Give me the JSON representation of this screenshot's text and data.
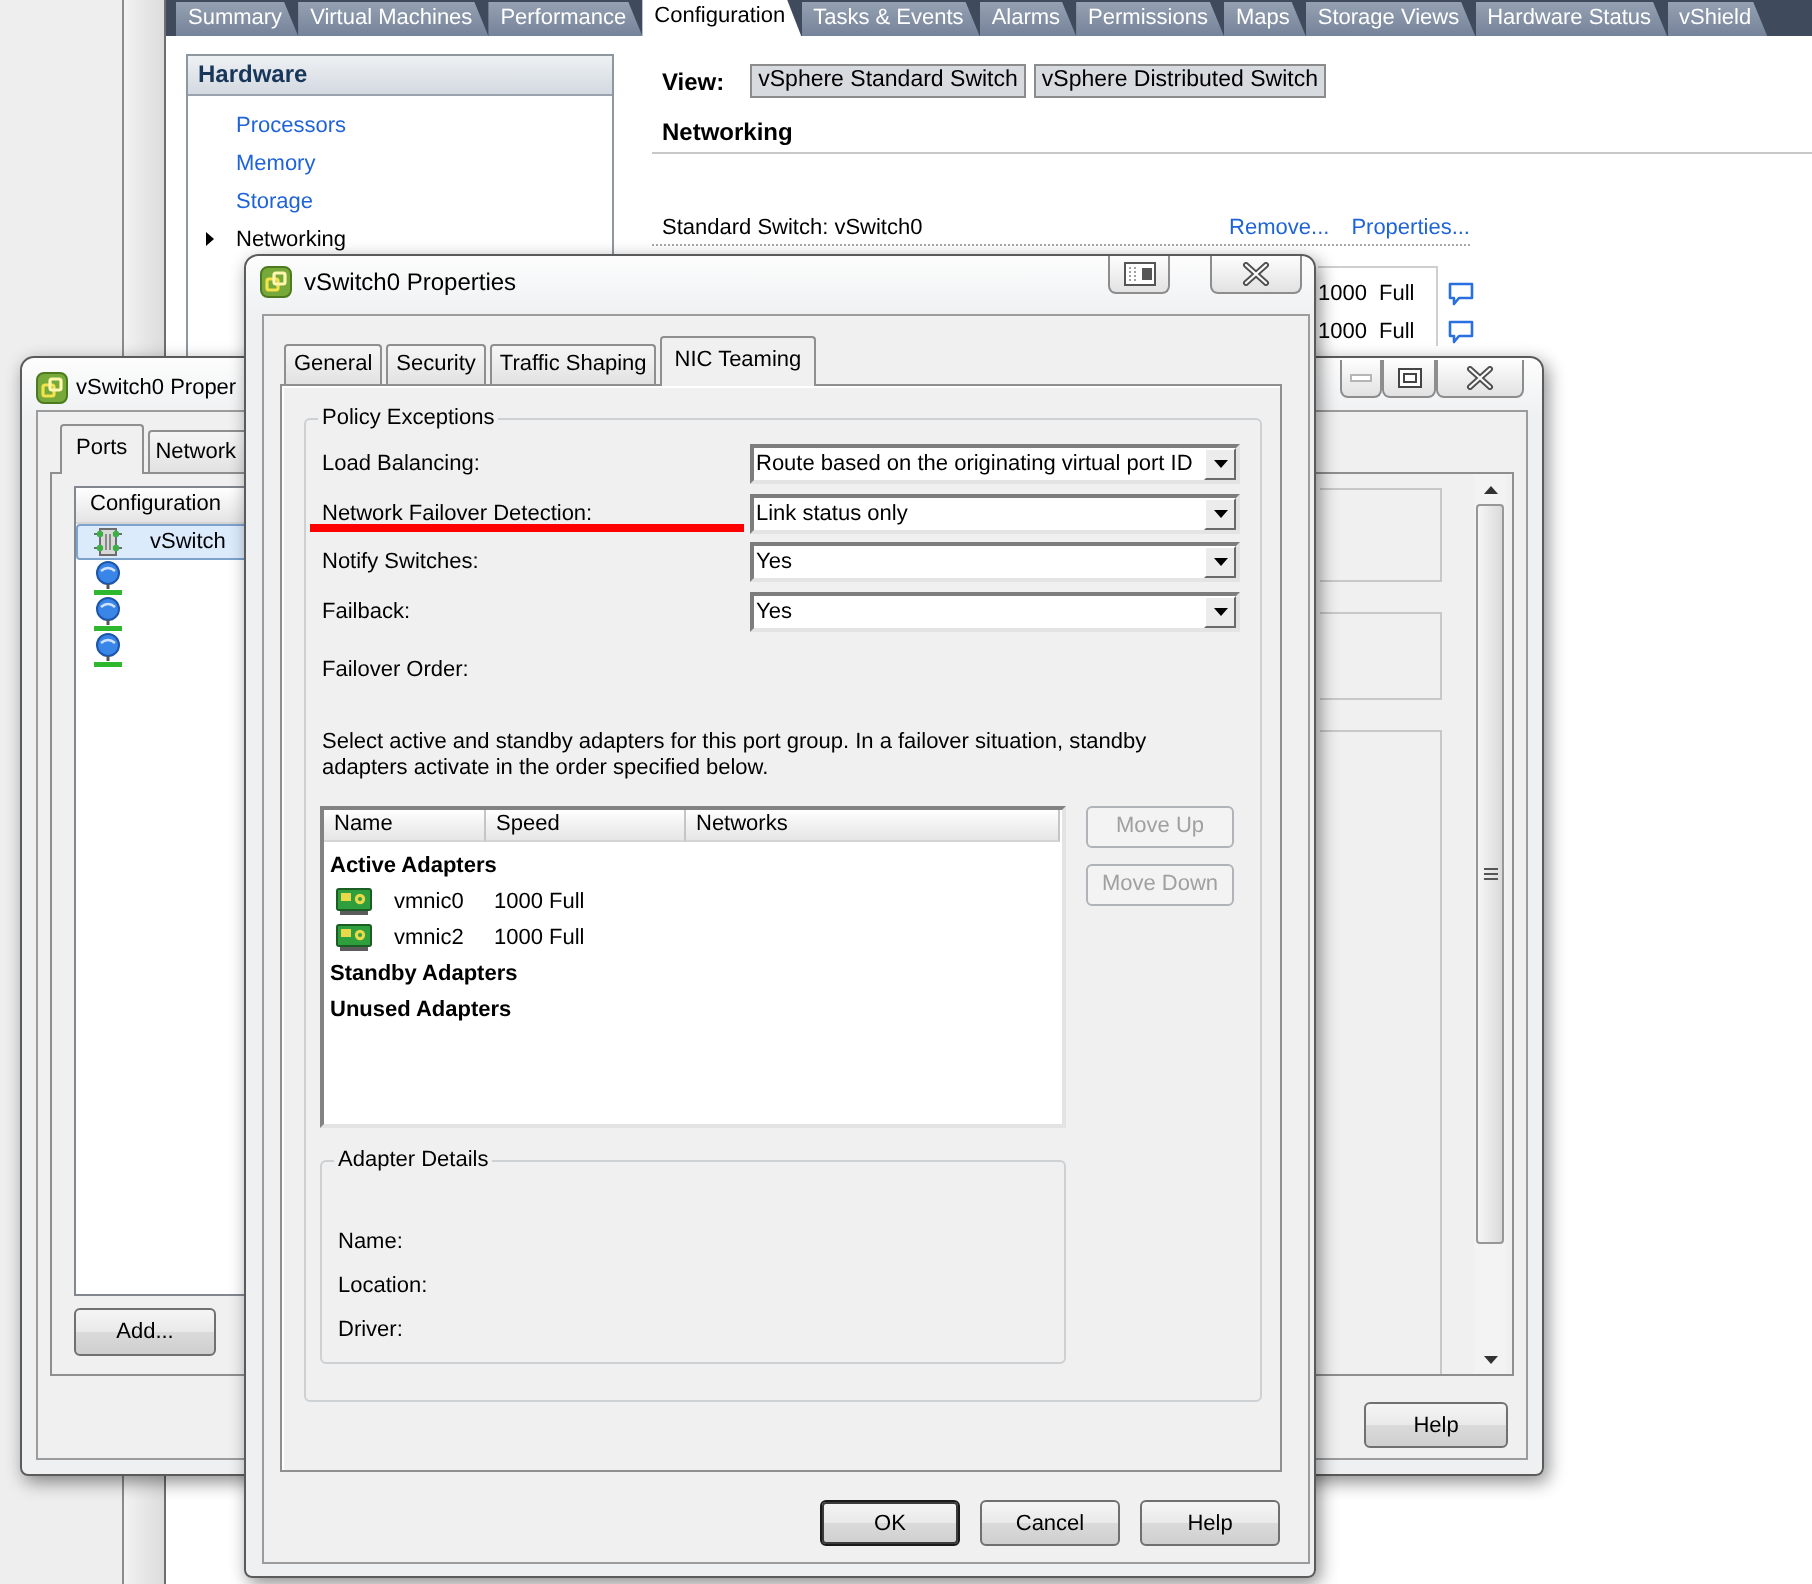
{
  "client": {
    "tabs": [
      {
        "label": "Summary",
        "selected": false
      },
      {
        "label": "Virtual Machines",
        "selected": false
      },
      {
        "label": "Performance",
        "selected": false
      },
      {
        "label": "Configuration",
        "selected": true
      },
      {
        "label": "Tasks & Events",
        "selected": false
      },
      {
        "label": "Alarms",
        "selected": false
      },
      {
        "label": "Permissions",
        "selected": false
      },
      {
        "label": "Maps",
        "selected": false
      },
      {
        "label": "Storage Views",
        "selected": false
      },
      {
        "label": "Hardware Status",
        "selected": false
      },
      {
        "label": "vShield",
        "selected": false
      }
    ],
    "hardware_panel": {
      "title": "Hardware",
      "items": [
        {
          "label": "Processors",
          "selected": false
        },
        {
          "label": "Memory",
          "selected": false
        },
        {
          "label": "Storage",
          "selected": false
        },
        {
          "label": "Networking",
          "selected": true
        }
      ]
    },
    "view": {
      "label": "View:",
      "buttons": [
        "vSphere Standard Switch",
        "vSphere Distributed Switch"
      ]
    },
    "section_title": "Networking",
    "switch": {
      "label": "Standard Switch: vSwitch0",
      "links": [
        "Remove...",
        "Properties..."
      ],
      "adapters": [
        "1000 Full",
        "1000 Full"
      ]
    }
  },
  "back_window": {
    "title": "vSwitch0 Proper",
    "tabs": [
      {
        "label": "Ports",
        "selected": true
      },
      {
        "label": "Network",
        "selected": false
      }
    ],
    "list": {
      "column": "Configuration",
      "rows": [
        {
          "kind": "switch",
          "label": "vSwitch",
          "selected": true
        },
        {
          "kind": "port_group",
          "selected": false
        },
        {
          "kind": "port_group",
          "selected": false
        },
        {
          "kind": "port_group",
          "selected": false
        }
      ]
    },
    "buttons": [
      "Add...",
      "Help"
    ]
  },
  "dialog": {
    "title": "vSwitch0 Properties",
    "tabs": [
      {
        "label": "General",
        "selected": false
      },
      {
        "label": "Security",
        "selected": false
      },
      {
        "label": "Traffic Shaping",
        "selected": false
      },
      {
        "label": "NIC Teaming",
        "selected": true
      }
    ],
    "policy_group": {
      "title": "Policy Exceptions",
      "settings": [
        {
          "label": "Load Balancing:",
          "value": "Route based on the originating virtual port ID",
          "marked": false
        },
        {
          "label": "Network Failover Detection:",
          "value": "Link status only",
          "marked": true
        },
        {
          "label": "Notify Switches:",
          "value": "Yes",
          "marked": false
        },
        {
          "label": "Failback:",
          "value": "Yes",
          "marked": false
        }
      ],
      "failover_order_label": "Failover Order:",
      "instructions": "Select active and standby adapters for this port group. In a failover situation, standby adapters activate in the order specified below.",
      "adapter_table": {
        "columns": [
          "Name",
          "Speed",
          "Networks"
        ],
        "groups": [
          {
            "title": "Active Adapters",
            "adapters": [
              {
                "name": "vmnic0",
                "speed": "1000 Full"
              },
              {
                "name": "vmnic2",
                "speed": "1000 Full"
              }
            ]
          },
          {
            "title": "Standby Adapters"
          },
          {
            "title": "Unused Adapters"
          }
        ]
      },
      "move_buttons": [
        {
          "label": "Move Up",
          "disabled": true
        },
        {
          "label": "Move Down",
          "disabled": true
        }
      ],
      "adapter_details": {
        "title": "Adapter Details",
        "fields": [
          "Name:",
          "Location:",
          "Driver:"
        ]
      }
    },
    "buttons": [
      {
        "label": "OK",
        "default": true
      },
      {
        "label": "Cancel",
        "default": false
      },
      {
        "label": "Help",
        "default": false
      }
    ]
  }
}
